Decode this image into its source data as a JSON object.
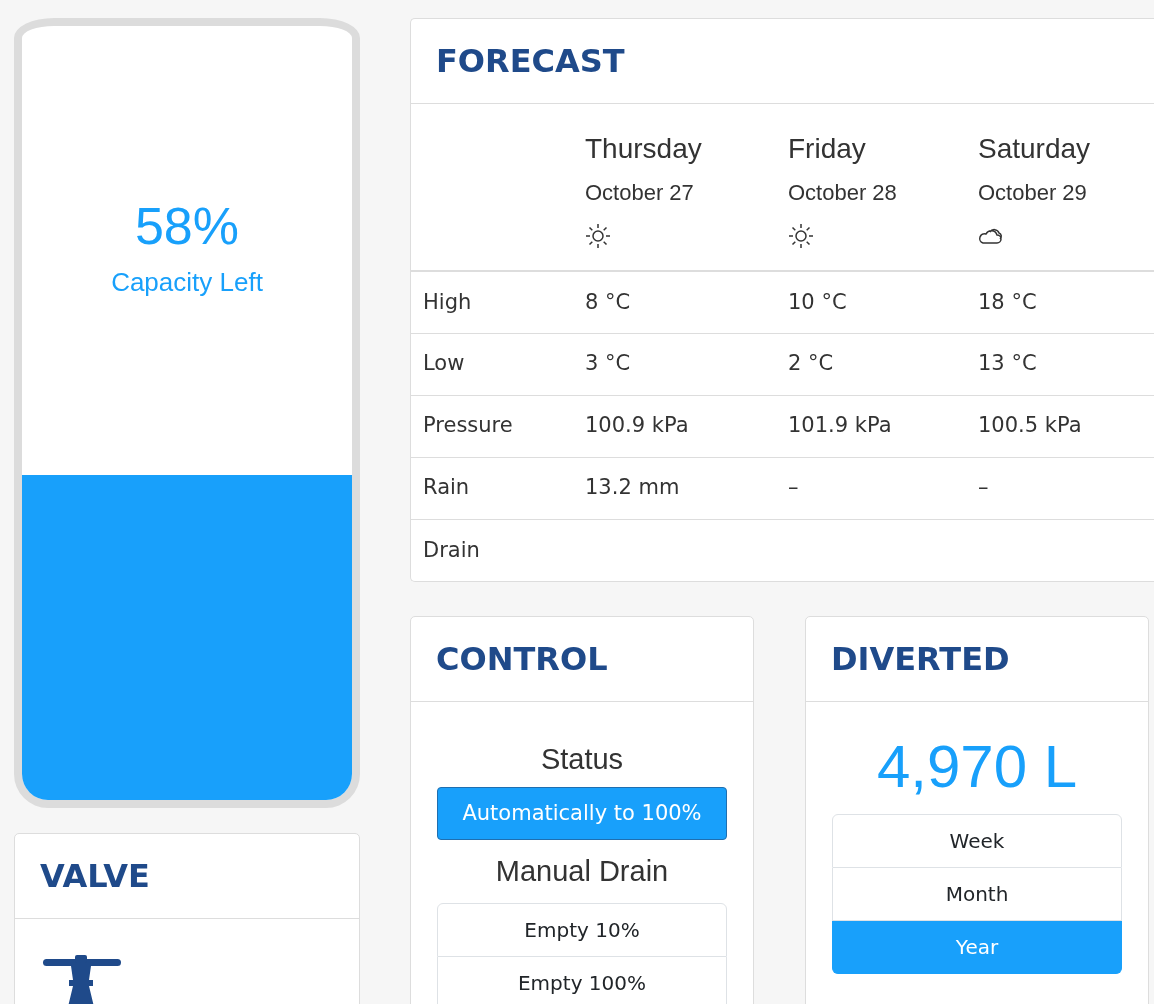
{
  "tank": {
    "percent": "58%",
    "caption": "Capacity Left"
  },
  "valve": {
    "title": "VALVE"
  },
  "forecast": {
    "title": "FORECAST",
    "days": [
      {
        "day": "Thursday",
        "date": "October 27",
        "kind": "sun"
      },
      {
        "day": "Friday",
        "date": "October 28",
        "kind": "sun"
      },
      {
        "day": "Saturday",
        "date": "October 29",
        "kind": "cloud"
      }
    ],
    "rows": [
      {
        "label": "High",
        "values": [
          "8 °C",
          "10 °C",
          "18 °C"
        ]
      },
      {
        "label": "Low",
        "values": [
          "3 °C",
          "2 °C",
          "13 °C"
        ]
      },
      {
        "label": "Pressure",
        "values": [
          "100.9 kPa",
          "101.9 kPa",
          "100.5 kPa"
        ]
      },
      {
        "label": "Rain",
        "values": [
          "13.2 mm",
          "–",
          "–"
        ]
      },
      {
        "label": "Drain",
        "values": []
      }
    ]
  },
  "control": {
    "title": "CONTROL",
    "status_label": "Status",
    "status_button": "Automatically to 100%",
    "manual_label": "Manual Drain",
    "manual_buttons": [
      "Empty 10%",
      "Empty 100%"
    ]
  },
  "diverted": {
    "title": "DIVERTED",
    "amount": "4,970 L",
    "periods": [
      {
        "label": "Week",
        "selected": false
      },
      {
        "label": "Month",
        "selected": false
      },
      {
        "label": "Year",
        "selected": true
      }
    ]
  }
}
